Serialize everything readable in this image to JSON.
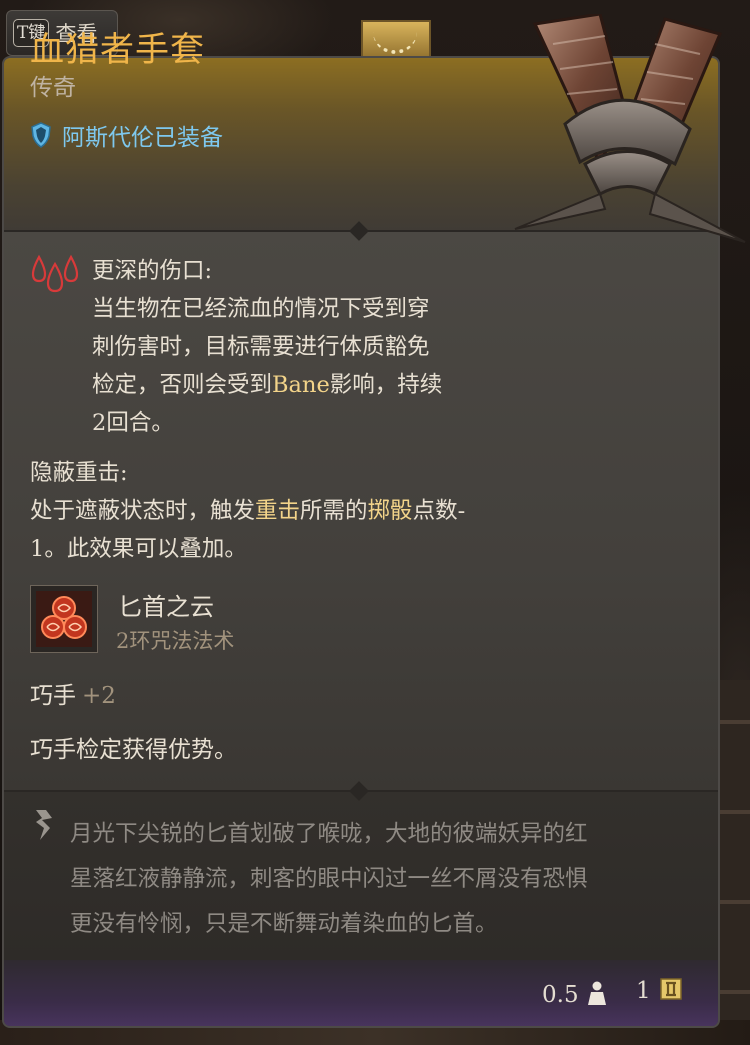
{
  "hud": {
    "key": "T键",
    "action": "查看"
  },
  "item": {
    "name": "血猎者手套",
    "rarity": "传奇",
    "equipped_by": "阿斯代伦已装备"
  },
  "passives": [
    {
      "title": "更深的伤口:",
      "lines": [
        "当生物在已经流血的情况下受到穿",
        "刺伤害时，目标需要进行体质豁免",
        "检定，否则会受到",
        "Bane",
        "影响，持续",
        "2回合。"
      ]
    },
    {
      "title": "隐蔽重击:",
      "line1_a": "处于遮蔽状态时，触发",
      "line1_hl1": "重击",
      "line1_b": "所需的",
      "line1_hl2": "掷骰",
      "line1_c": "点数-",
      "line2": "1。此效果可以叠加。"
    }
  ],
  "spell": {
    "name": "匕首之云",
    "level": "2环咒法法术"
  },
  "stat": {
    "name": "巧手",
    "value": "+2"
  },
  "advantage": "巧手检定获得优势。",
  "lore": [
    "月光下尖锐的匕首划破了喉咙，大地的彼端妖异的红",
    "星落红液静静流，刺客的眼中闪过一丝不屑没有恐惧",
    "更没有怜悯，只是不断舞动着染血的匕首。"
  ],
  "footer": {
    "weight": "0.5",
    "price": "1"
  },
  "colors": {
    "title": "#f0b54a",
    "equipped": "#7ec8ee",
    "highlight": "#f3d48a",
    "footer_purple": "#4a3560"
  },
  "icons": [
    "shield-icon",
    "blood-drops-icon",
    "quill-icon",
    "weight-icon",
    "coin-icon",
    "gloves-icon",
    "dagger-cloud-icon"
  ]
}
